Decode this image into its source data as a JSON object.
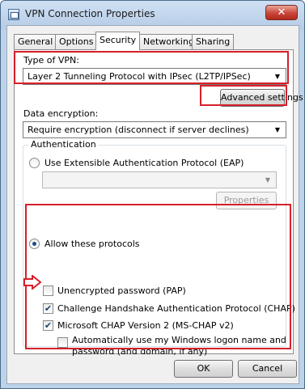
{
  "window": {
    "title": "VPN Connection Properties",
    "close_glyph": "✕"
  },
  "tabs": [
    {
      "label": "General"
    },
    {
      "label": "Options"
    },
    {
      "label": "Security",
      "active": true
    },
    {
      "label": "Networking"
    },
    {
      "label": "Sharing"
    }
  ],
  "security": {
    "vpn_type_label": "Type of VPN:",
    "vpn_type_value": "Layer 2 Tunneling Protocol with IPsec (L2TP/IPSec)",
    "advanced_settings": "Advanced settings",
    "encryption_label": "Data encryption:",
    "encryption_value": "Require encryption (disconnect if server declines)",
    "auth_group": "Authentication",
    "eap_label": "Use Extensible Authentication Protocol (EAP)",
    "eap_value": "",
    "properties_label": "Properties",
    "allow_label": "Allow these protocols",
    "pap_label": "Unencrypted password (PAP)",
    "chap_label": "Challenge Handshake Authentication Protocol (CHAP)",
    "mschap_label": "Microsoft CHAP Version 2 (MS-CHAP v2)",
    "autologon_label_1": "Automatically use my Windows logon name and",
    "autologon_label_2": "password (and domain, if any)",
    "pap_checked": false,
    "chap_checked": true,
    "mschap_checked": true,
    "autologon_checked": false
  },
  "footer": {
    "ok": "OK",
    "cancel": "Cancel"
  },
  "colors": {
    "highlight": "#d6202a",
    "accent": "#1b4e8c"
  }
}
